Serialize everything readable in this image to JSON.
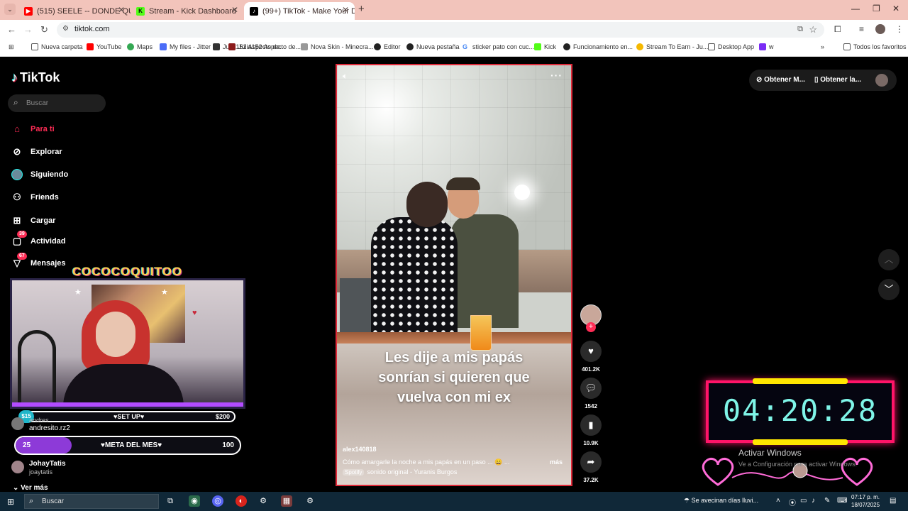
{
  "browser": {
    "tabs": [
      {
        "title": "(515) SEELE -- DONDE QUIERAS",
        "favicon_color": "#ff0000"
      },
      {
        "title": "Stream - Kick Dashboard",
        "favicon_color": "#53fc18"
      },
      {
        "title": "(99+) TikTok - Make Your Day",
        "favicon_color": "#000000"
      }
    ],
    "url": "tiktok.com",
    "bookmarks": [
      "Nueva carpeta",
      "YouTube",
      "Maps",
      "My files - Jitter",
      "Julia152 Aspecto de...",
      "Nova Skin - Minecra...",
      "Editor",
      "Nueva pestaña",
      "sticker pato con cuc...",
      "Kick",
      "Funcionamiento en...",
      "Stream To Earn - Ju...",
      "Desktop App",
      "w"
    ],
    "all_bookmarks": "Todos los favoritos"
  },
  "tiktok": {
    "logo": "TikTok",
    "search_placeholder": "Buscar",
    "nav": {
      "para_ti": "Para ti",
      "explorar": "Explorar",
      "siguiendo": "Siguiendo",
      "friends": "Friends",
      "cargar": "Cargar",
      "actividad": "Actividad",
      "actividad_badge": "39",
      "mensajes": "Mensajes",
      "mensajes_badge": "67"
    },
    "following": [
      {
        "name": "andresito.rz2",
        "user": "andres"
      },
      {
        "name": "JohayTatis",
        "user": "joaytatis"
      }
    ],
    "ver_mas": "Ver más",
    "top_right": {
      "btn1": "Obtener M...",
      "btn2": "Obtener la..."
    },
    "video": {
      "caption_line1": "Les dije a mis papás",
      "caption_line2": "sonrían si quieren que",
      "caption_line3": "vuelva con mi ex",
      "author": "alex140818",
      "description": "Cómo amargarle la noche a mis papás en un paso ... 😄 ...",
      "more": "más",
      "sound_tag": "Spotify",
      "sound": "sonido original - Yuranis Burgos",
      "likes": "401.2K",
      "comments": "1542",
      "saves": "10.9K",
      "shares": "37.2K"
    }
  },
  "stream_overlay": {
    "title": "COCOCOQUITOO",
    "goal_left": "$15",
    "goal_mid": "♥SET UP♥",
    "goal_right": "$200",
    "meta_left": "25",
    "meta_mid": "♥META DEL MES♥",
    "meta_right": "100",
    "meta_progress": 0.25,
    "timer": "04:20:28",
    "activate_title": "Activar Windows",
    "activate_sub": "Ve a Configuración para activar Windows."
  },
  "taskbar": {
    "search": "Buscar",
    "weather": "Se avecinan días lluvi...",
    "time": "07:17 p. m.",
    "date": "18/07/2025"
  },
  "colors": {
    "accent": "#fe2c55",
    "timer_border": "#ff1468",
    "timer_text": "#7ff5e8",
    "meta_fill": "#8d3ad8"
  }
}
